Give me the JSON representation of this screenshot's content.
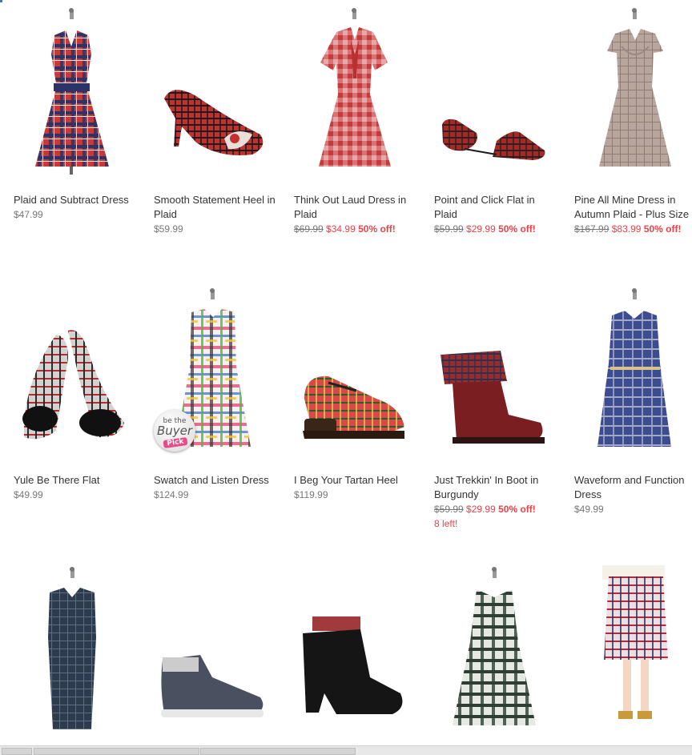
{
  "colors": {
    "sale": "#e8434a",
    "text": "#333333",
    "price": "#777777"
  },
  "products": [
    {
      "name": "Plaid and Subtract Dress",
      "price": "$47.99",
      "image": "plaid-red-dress"
    },
    {
      "name": "Smooth Statement Heel in Plaid",
      "price": "$59.99",
      "image": "plaid-heel"
    },
    {
      "name": "Think Out Laud Dress in Plaid",
      "original_price": "$69.99",
      "sale_price": "$34.99",
      "discount": "50% off!",
      "image": "gingham-dress"
    },
    {
      "name": "Point and Click Flat in Plaid",
      "original_price": "$59.99",
      "sale_price": "$29.99",
      "discount": "50% off!",
      "image": "plaid-flat"
    },
    {
      "name": "Pine All Mine Dress in Autumn Plaid - Plus Size",
      "original_price": "$167.99",
      "sale_price": "$83.99",
      "discount": "50% off!",
      "image": "taupe-dress"
    },
    {
      "name": "Yule Be There Flat",
      "price": "$49.99",
      "image": "bow-flats"
    },
    {
      "name": "Swatch and Listen Dress",
      "price": "$124.99",
      "image": "multicolor-plaid-dress",
      "badge": {
        "line1": "be the",
        "line2": "Buyer",
        "line3": "Pick"
      }
    },
    {
      "name": "I Beg Your Tartan Heel",
      "price": "$119.99",
      "image": "tartan-mary-jane"
    },
    {
      "name": "Just Trekkin' In Boot in Burgundy",
      "original_price": "$59.99",
      "sale_price": "$29.99",
      "discount": "50% off!",
      "stock": "8 left!",
      "image": "burgundy-boot"
    },
    {
      "name": "Waveform and Function Dress",
      "price": "$49.99",
      "image": "blue-plaid-dress"
    },
    {
      "name": "",
      "price": "",
      "image": "navy-plaid-sheath"
    },
    {
      "name": "",
      "price": "",
      "image": "grey-sneaker"
    },
    {
      "name": "",
      "price": "",
      "image": "black-bootie"
    },
    {
      "name": "",
      "price": "",
      "image": "green-plaid-dress"
    },
    {
      "name": "",
      "price": "",
      "image": "plaid-skirt"
    }
  ]
}
